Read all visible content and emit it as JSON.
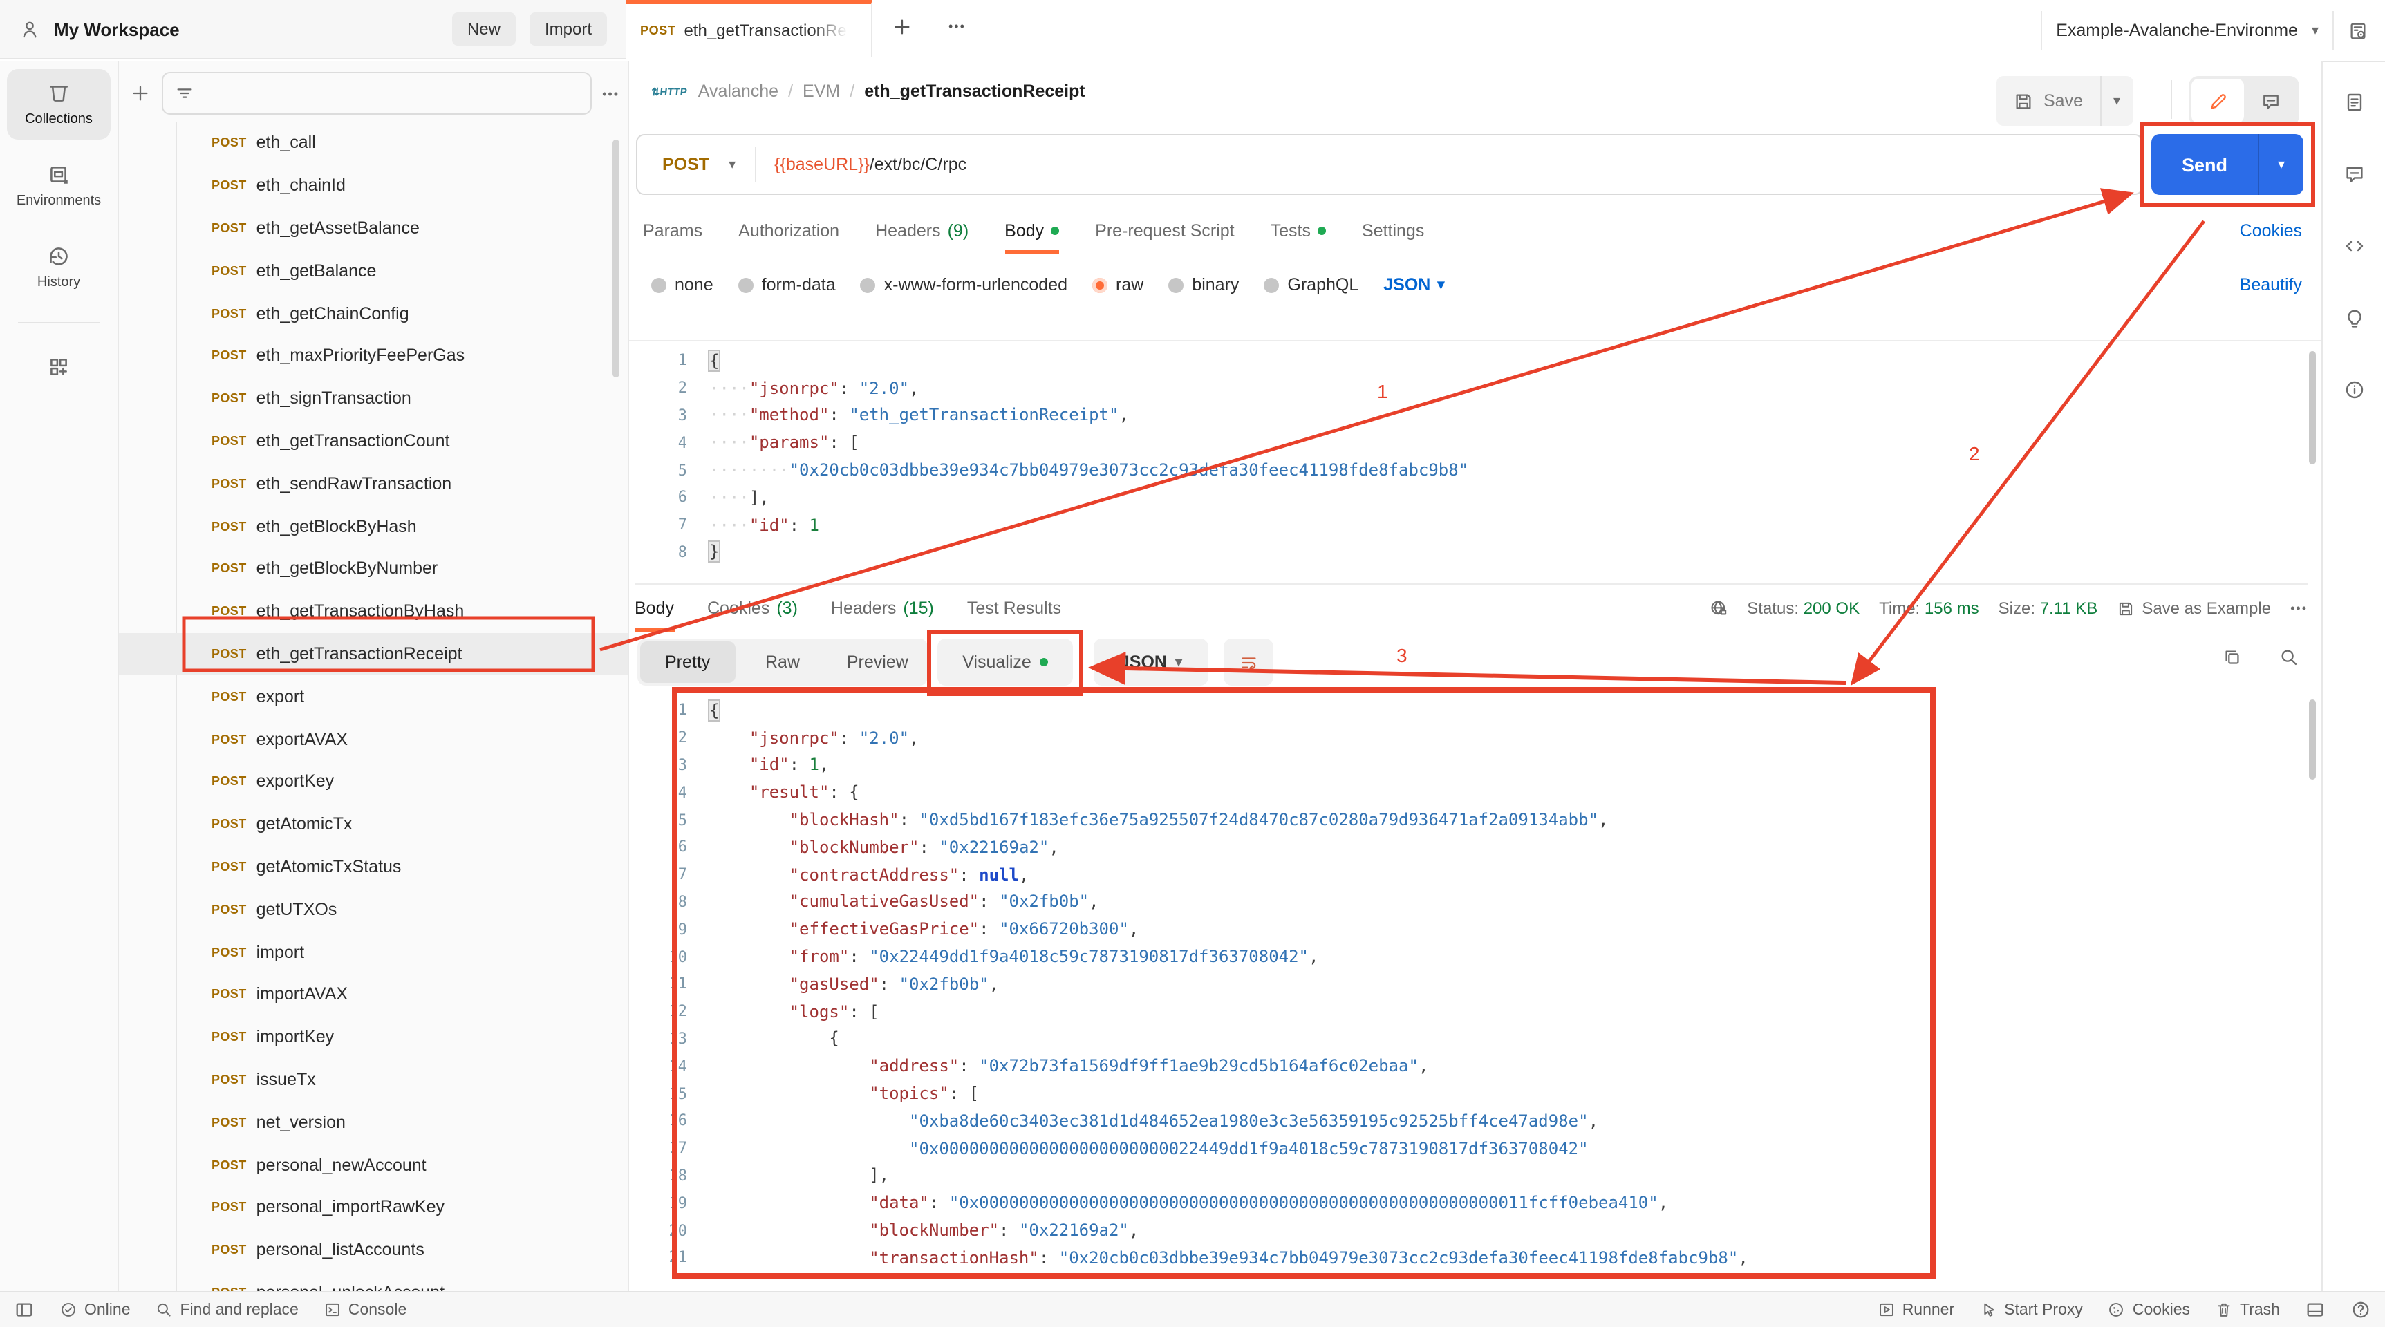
{
  "colors": {
    "accent": "#ff6c37",
    "send_blue": "#2b6ce8",
    "link_blue": "#0265d2",
    "method_amber": "#a26b00",
    "success_green": "#0e7e3c",
    "dot_green": "#1faa53",
    "annotation_red": "#e8402a"
  },
  "topbar": {
    "workspace": "My Workspace",
    "new_button": "New",
    "import_button": "Import",
    "tab_method": "POST",
    "tab_label": "eth_getTransactionRece",
    "more": "•••",
    "environment": "Example-Avalanche-Environme"
  },
  "left_rail": {
    "items": [
      {
        "label": "Collections",
        "icon": "collections-icon",
        "active": true
      },
      {
        "label": "Environments",
        "icon": "environments-icon",
        "active": false
      },
      {
        "label": "History",
        "icon": "history-icon",
        "active": false
      }
    ]
  },
  "sidebar": {
    "method_label": "POST",
    "selected_index": 12,
    "items": [
      "eth_call",
      "eth_chainId",
      "eth_getAssetBalance",
      "eth_getBalance",
      "eth_getChainConfig",
      "eth_maxPriorityFeePerGas",
      "eth_signTransaction",
      "eth_getTransactionCount",
      "eth_sendRawTransaction",
      "eth_getBlockByHash",
      "eth_getBlockByNumber",
      "eth_getTransactionByHash",
      "eth_getTransactionReceipt",
      "export",
      "exportAVAX",
      "exportKey",
      "getAtomicTx",
      "getAtomicTxStatus",
      "getUTXOs",
      "import",
      "importAVAX",
      "importKey",
      "issueTx",
      "net_version",
      "personal_newAccount",
      "personal_importRawKey",
      "personal_listAccounts",
      "personal_unlockAccount"
    ]
  },
  "request": {
    "breadcrumb_1": "Avalanche",
    "breadcrumb_2": "EVM",
    "breadcrumb_3": "eth_getTransactionReceipt",
    "save_label": "Save",
    "method": "POST",
    "url_var": "{{baseURL}}",
    "url_path": "/ext/bc/C/rpc",
    "send_label": "Send",
    "cookies_link": "Cookies",
    "beautify_link": "Beautify",
    "tabs": [
      {
        "label": "Params"
      },
      {
        "label": "Authorization"
      },
      {
        "label": "Headers",
        "count": "(9)"
      },
      {
        "label": "Body",
        "dot": true,
        "active": true
      },
      {
        "label": "Pre-request Script"
      },
      {
        "label": "Tests",
        "dot": true
      },
      {
        "label": "Settings"
      }
    ],
    "modes": [
      {
        "label": "none"
      },
      {
        "label": "form-data"
      },
      {
        "label": "x-www-form-urlencoded"
      },
      {
        "label": "raw",
        "selected": true
      },
      {
        "label": "binary"
      },
      {
        "label": "GraphQL"
      }
    ],
    "lang": "JSON"
  },
  "request_editor": {
    "lines": [
      [
        [
          "pm",
          "{"
        ]
      ],
      [
        [
          "wsd",
          "····"
        ],
        [
          "key",
          "\"jsonrpc\""
        ],
        [
          "p",
          ": "
        ],
        [
          "str",
          "\"2.0\""
        ],
        [
          "p",
          ","
        ]
      ],
      [
        [
          "wsd",
          "····"
        ],
        [
          "key",
          "\"method\""
        ],
        [
          "p",
          ": "
        ],
        [
          "str",
          "\"eth_getTransactionReceipt\""
        ],
        [
          "p",
          ","
        ]
      ],
      [
        [
          "wsd",
          "····"
        ],
        [
          "key",
          "\"params\""
        ],
        [
          "p",
          ": "
        ],
        [
          "p",
          "["
        ]
      ],
      [
        [
          "wsd",
          "········"
        ],
        [
          "str",
          "\"0x20cb0c03dbbe39e934c7bb04979e3073cc2c93defa30feec41198fde8fabc9b8\""
        ]
      ],
      [
        [
          "wsd",
          "····"
        ],
        [
          "p",
          "],"
        ]
      ],
      [
        [
          "wsd",
          "····"
        ],
        [
          "key",
          "\"id\""
        ],
        [
          "p",
          ": "
        ],
        [
          "num",
          "1"
        ]
      ],
      [
        [
          "pm",
          "}"
        ]
      ]
    ]
  },
  "response": {
    "tabs": [
      {
        "label": "Body",
        "active": true
      },
      {
        "label": "Cookies",
        "count": "(3)"
      },
      {
        "label": "Headers",
        "count": "(15)"
      },
      {
        "label": "Test Results"
      }
    ],
    "status_label": "Status:",
    "status_value": "200 OK",
    "time_label": "Time:",
    "time_value": "156 ms",
    "size_label": "Size:",
    "size_value": "7.11 KB",
    "save_example": "Save as Example",
    "more": "•••",
    "view_pretty": "Pretty",
    "view_raw": "Raw",
    "view_preview": "Preview",
    "view_visualize": "Visualize",
    "lang": "JSON"
  },
  "response_editor": {
    "lines": [
      [
        [
          "pm",
          "{"
        ]
      ],
      [
        [
          "w",
          "    "
        ],
        [
          "key",
          "\"jsonrpc\""
        ],
        [
          "p",
          ": "
        ],
        [
          "str",
          "\"2.0\""
        ],
        [
          "p",
          ","
        ]
      ],
      [
        [
          "w",
          "    "
        ],
        [
          "key",
          "\"id\""
        ],
        [
          "p",
          ": "
        ],
        [
          "num",
          "1"
        ],
        [
          "p",
          ","
        ]
      ],
      [
        [
          "w",
          "    "
        ],
        [
          "key",
          "\"result\""
        ],
        [
          "p",
          ": {"
        ]
      ],
      [
        [
          "w",
          "        "
        ],
        [
          "key",
          "\"blockHash\""
        ],
        [
          "p",
          ": "
        ],
        [
          "str",
          "\"0xd5bd167f183efc36e75a925507f24d8470c87c0280a79d936471af2a09134abb\""
        ],
        [
          "p",
          ","
        ]
      ],
      [
        [
          "w",
          "        "
        ],
        [
          "key",
          "\"blockNumber\""
        ],
        [
          "p",
          ": "
        ],
        [
          "str",
          "\"0x22169a2\""
        ],
        [
          "p",
          ","
        ]
      ],
      [
        [
          "w",
          "        "
        ],
        [
          "key",
          "\"contractAddress\""
        ],
        [
          "p",
          ": "
        ],
        [
          "nul",
          "null"
        ],
        [
          "p",
          ","
        ]
      ],
      [
        [
          "w",
          "        "
        ],
        [
          "key",
          "\"cumulativeGasUsed\""
        ],
        [
          "p",
          ": "
        ],
        [
          "str",
          "\"0x2fb0b\""
        ],
        [
          "p",
          ","
        ]
      ],
      [
        [
          "w",
          "        "
        ],
        [
          "key",
          "\"effectiveGasPrice\""
        ],
        [
          "p",
          ": "
        ],
        [
          "str",
          "\"0x66720b300\""
        ],
        [
          "p",
          ","
        ]
      ],
      [
        [
          "w",
          "        "
        ],
        [
          "key",
          "\"from\""
        ],
        [
          "p",
          ": "
        ],
        [
          "str",
          "\"0x22449dd1f9a4018c59c7873190817df363708042\""
        ],
        [
          "p",
          ","
        ]
      ],
      [
        [
          "w",
          "        "
        ],
        [
          "key",
          "\"gasUsed\""
        ],
        [
          "p",
          ": "
        ],
        [
          "str",
          "\"0x2fb0b\""
        ],
        [
          "p",
          ","
        ]
      ],
      [
        [
          "w",
          "        "
        ],
        [
          "key",
          "\"logs\""
        ],
        [
          "p",
          ": ["
        ]
      ],
      [
        [
          "w",
          "            "
        ],
        [
          "p",
          "{"
        ]
      ],
      [
        [
          "w",
          "                "
        ],
        [
          "key",
          "\"address\""
        ],
        [
          "p",
          ": "
        ],
        [
          "str",
          "\"0x72b73fa1569df9ff1ae9b29cd5b164af6c02ebaa\""
        ],
        [
          "p",
          ","
        ]
      ],
      [
        [
          "w",
          "                "
        ],
        [
          "key",
          "\"topics\""
        ],
        [
          "p",
          ": ["
        ]
      ],
      [
        [
          "w",
          "                    "
        ],
        [
          "str",
          "\"0xba8de60c3403ec381d1d484652ea1980e3c3e56359195c92525bff4ce47ad98e\""
        ],
        [
          "p",
          ","
        ]
      ],
      [
        [
          "w",
          "                    "
        ],
        [
          "str",
          "\"0x00000000000000000000000022449dd1f9a4018c59c7873190817df363708042\""
        ]
      ],
      [
        [
          "w",
          "                "
        ],
        [
          "p",
          "],"
        ]
      ],
      [
        [
          "w",
          "                "
        ],
        [
          "key",
          "\"data\""
        ],
        [
          "p",
          ": "
        ],
        [
          "str",
          "\"0x0000000000000000000000000000000000000000000000000000011fcff0ebea410\""
        ],
        [
          "p",
          ","
        ]
      ],
      [
        [
          "w",
          "                "
        ],
        [
          "key",
          "\"blockNumber\""
        ],
        [
          "p",
          ": "
        ],
        [
          "str",
          "\"0x22169a2\""
        ],
        [
          "p",
          ","
        ]
      ],
      [
        [
          "w",
          "                "
        ],
        [
          "key",
          "\"transactionHash\""
        ],
        [
          "p",
          ": "
        ],
        [
          "str",
          "\"0x20cb0c03dbbe39e934c7bb04979e3073cc2c93defa30feec41198fde8fabc9b8\""
        ],
        [
          "p",
          ","
        ]
      ]
    ]
  },
  "statusbar": {
    "online": "Online",
    "find": "Find and replace",
    "console": "Console",
    "runner": "Runner",
    "proxy": "Start Proxy",
    "cookies": "Cookies",
    "trash": "Trash"
  },
  "annotations": {
    "one": "1",
    "two": "2",
    "three": "3"
  }
}
